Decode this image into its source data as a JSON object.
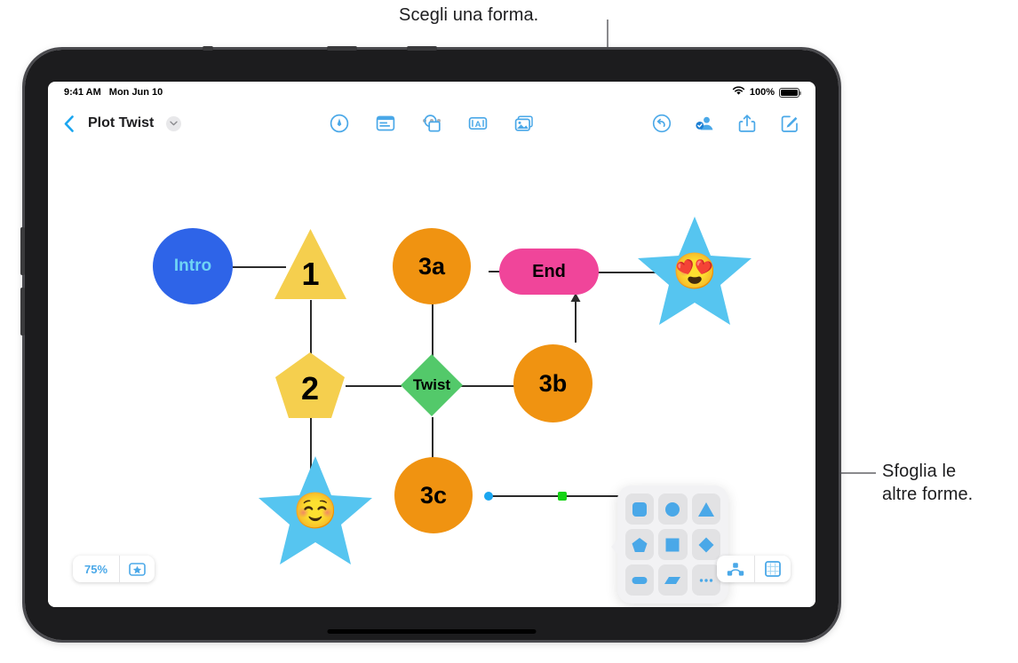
{
  "callouts": {
    "top": "Scegli una forma.",
    "right": "Sfoglia le\naltre forme."
  },
  "status_bar": {
    "time": "9:41 AM",
    "date": "Mon Jun 10",
    "wifi_icon": "wifi-icon",
    "battery_percent": "100%",
    "battery_icon": "battery-full-icon"
  },
  "nav_bar": {
    "back_icon": "back-chevron-icon",
    "title": "Plot Twist",
    "title_chevron_icon": "chevron-down-icon",
    "center_tools": [
      {
        "name": "draw-tool",
        "icon": "pen-circle-icon"
      },
      {
        "name": "text-tool",
        "icon": "text-box-icon"
      },
      {
        "name": "shapes-tool",
        "icon": "shapes-icon"
      },
      {
        "name": "text-style-tool",
        "icon": "letter-a-box-icon"
      },
      {
        "name": "media-tool",
        "icon": "media-stack-icon"
      }
    ],
    "right_tools": [
      {
        "name": "undo-button",
        "icon": "undo-arrow-icon"
      },
      {
        "name": "collaborate-button",
        "icon": "collaborate-person-icon"
      },
      {
        "name": "share-button",
        "icon": "share-up-arrow-icon"
      },
      {
        "name": "compose-button",
        "icon": "compose-pencil-icon"
      }
    ]
  },
  "diagram": {
    "nodes": [
      {
        "id": "intro",
        "label": "Intro",
        "shape": "circle",
        "fill": "#2e64e8",
        "text_color": "#6fd4f5",
        "font_size": 19
      },
      {
        "id": "n1",
        "label": "1",
        "shape": "triangle",
        "fill": "#f5cf4e",
        "text_color": "#000000",
        "font_size": 36
      },
      {
        "id": "n2",
        "label": "2",
        "shape": "pentagon",
        "fill": "#f5cf4e",
        "text_color": "#000000",
        "font_size": 36
      },
      {
        "id": "n3a",
        "label": "3a",
        "shape": "circle",
        "fill": "#f09311",
        "text_color": "#000000",
        "font_size": 27
      },
      {
        "id": "twist",
        "label": "Twist",
        "shape": "diamond",
        "fill": "#53c96a",
        "text_color": "#000000",
        "font_size": 17
      },
      {
        "id": "n3b",
        "label": "3b",
        "shape": "circle",
        "fill": "#f09311",
        "text_color": "#000000",
        "font_size": 27
      },
      {
        "id": "n3c",
        "label": "3c",
        "shape": "circle",
        "fill": "#f09311",
        "text_color": "#000000",
        "font_size": 27
      },
      {
        "id": "end",
        "label": "End",
        "shape": "rounded-rect",
        "fill": "#f0459a",
        "text_color": "#000000",
        "font_size": 20
      },
      {
        "id": "star-top",
        "label": "😍",
        "shape": "star",
        "fill": "#56c5f0",
        "text_color": "#000000",
        "font_size": 40
      },
      {
        "id": "star-bottom",
        "label": "☺️",
        "shape": "star",
        "fill": "#56c5f0",
        "text_color": "#000000",
        "font_size": 40
      }
    ],
    "selected_connector": {
      "name": "selected-connector",
      "start_handle_color": "#1ba6f0",
      "mid_handle_color": "#15d415",
      "end_handle_color": "#1ba6f0"
    }
  },
  "shape_picker": {
    "name": "shape-picker-popover",
    "shapes": [
      {
        "name": "rounded-square-shape",
        "icon": "rounded-square-icon"
      },
      {
        "name": "circle-shape",
        "icon": "circle-icon"
      },
      {
        "name": "triangle-shape",
        "icon": "triangle-icon"
      },
      {
        "name": "pentagon-shape",
        "icon": "pentagon-icon"
      },
      {
        "name": "square-shape",
        "icon": "square-icon"
      },
      {
        "name": "diamond-shape",
        "icon": "diamond-icon"
      },
      {
        "name": "ellipse-shape",
        "icon": "ellipse-icon"
      },
      {
        "name": "parallelogram-shape",
        "icon": "parallelogram-icon"
      },
      {
        "name": "more-shapes",
        "icon": "ellipsis-icon"
      }
    ],
    "accent_color": "#4aa8e8"
  },
  "bottom_bar": {
    "zoom_level": "75%",
    "zoom_star_icon": "star-in-box-icon",
    "connector_view_icon": "connector-nodes-icon",
    "grid_view_icon": "grid-square-icon"
  }
}
